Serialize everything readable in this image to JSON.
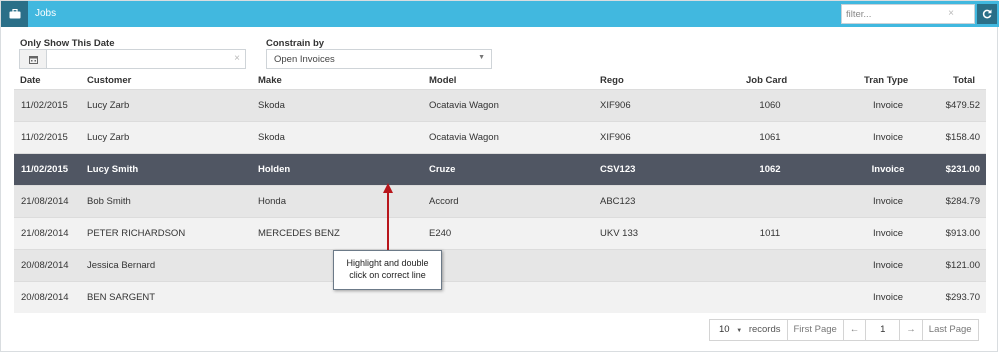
{
  "header": {
    "title": "Jobs",
    "filter_placeholder": "filter...",
    "filter_clear": "×"
  },
  "filters": {
    "date_label": "Only Show This Date",
    "date_value": "",
    "date_clear": "×",
    "constrain_label": "Constrain by",
    "constrain_value": "Open Invoices",
    "constrain_caret": "▼"
  },
  "table": {
    "columns": [
      "Date",
      "Customer",
      "Make",
      "Model",
      "Rego",
      "Job Card",
      "Tran Type",
      "Total"
    ],
    "rows": [
      {
        "date": "11/02/2015",
        "customer": "Lucy Zarb",
        "make": "Skoda",
        "model": "Ocatavia Wagon",
        "rego": "XIF906",
        "job_card": "1060",
        "tran_type": "Invoice",
        "total": "$479.52",
        "selected": false
      },
      {
        "date": "11/02/2015",
        "customer": "Lucy Zarb",
        "make": "Skoda",
        "model": "Ocatavia Wagon",
        "rego": "XIF906",
        "job_card": "1061",
        "tran_type": "Invoice",
        "total": "$158.40",
        "selected": false
      },
      {
        "date": "11/02/2015",
        "customer": "Lucy Smith",
        "make": "Holden",
        "model": "Cruze",
        "rego": "CSV123",
        "job_card": "1062",
        "tran_type": "Invoice",
        "total": "$231.00",
        "selected": true
      },
      {
        "date": "21/08/2014",
        "customer": "Bob Smith",
        "make": "Honda",
        "model": "Accord",
        "rego": "ABC123",
        "job_card": "",
        "tran_type": "Invoice",
        "total": "$284.79",
        "selected": false
      },
      {
        "date": "21/08/2014",
        "customer": "PETER RICHARDSON",
        "make": "MERCEDES BENZ",
        "model": "E240",
        "rego": "UKV 133",
        "job_card": "1011",
        "tran_type": "Invoice",
        "total": "$913.00",
        "selected": false
      },
      {
        "date": "20/08/2014",
        "customer": "Jessica Bernard",
        "make": "",
        "model": "",
        "rego": "",
        "job_card": "",
        "tran_type": "Invoice",
        "total": "$121.00",
        "selected": false
      },
      {
        "date": "20/08/2014",
        "customer": "BEN SARGENT",
        "make": "",
        "model": "",
        "rego": "",
        "job_card": "",
        "tran_type": "Invoice",
        "total": "$293.70",
        "selected": false
      }
    ]
  },
  "callout": {
    "line1": "Highlight and double",
    "line2": "click on correct line"
  },
  "pager": {
    "page_size": "10",
    "page_size_caret": "▼",
    "records_label": "records",
    "first_label": "First Page",
    "prev_label": "←",
    "current_page": "1",
    "next_label": "→",
    "last_label": "Last Page"
  },
  "colors": {
    "header_bg": "#41b8df",
    "header_dark": "#2a6f88",
    "selected_row": "#505663",
    "arrow": "#b8161c"
  },
  "icons": {
    "header": "briefcase-icon",
    "refresh": "refresh-icon",
    "date": "calendar-icon"
  }
}
